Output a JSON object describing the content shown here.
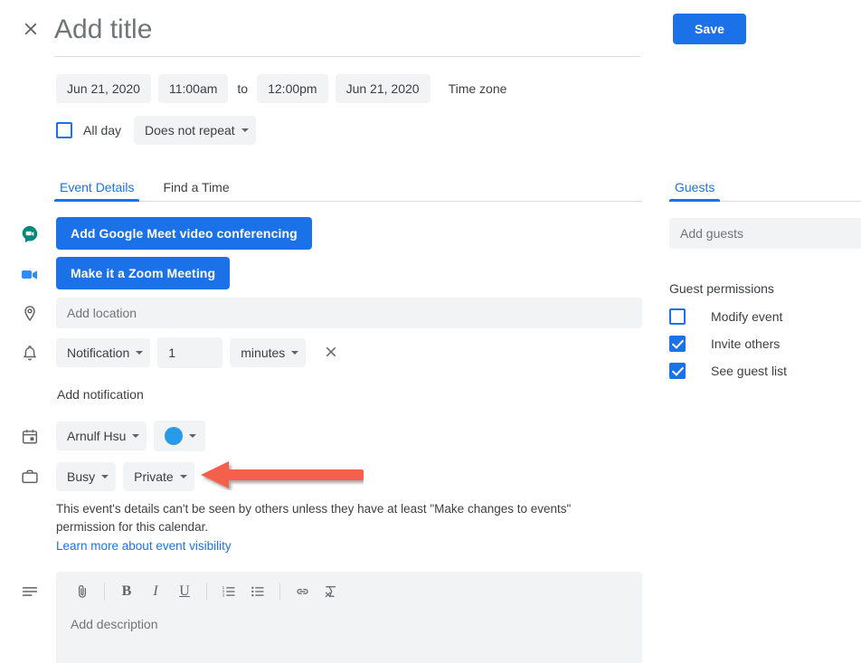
{
  "header": {
    "close_icon": "close-icon",
    "title_placeholder": "Add title",
    "title_value": "",
    "save_label": "Save"
  },
  "schedule": {
    "start_date": "Jun 21, 2020",
    "start_time": "11:00am",
    "to_label": "to",
    "end_time": "12:00pm",
    "end_date": "Jun 21, 2020",
    "timezone_label": "Time zone",
    "all_day_label": "All day",
    "all_day_checked": false,
    "repeat_label": "Does not repeat"
  },
  "tabs": {
    "items": [
      {
        "label": "Event Details",
        "active": true
      },
      {
        "label": "Find a Time",
        "active": false
      }
    ]
  },
  "details": {
    "meet_button_label": "Add Google Meet video conferencing",
    "zoom_button_label": "Make it a Zoom Meeting",
    "location_placeholder": "Add location",
    "location_value": "",
    "notification": {
      "type_label": "Notification",
      "amount_value": "1",
      "unit_label": "minutes",
      "remove_icon": "close-icon",
      "add_label": "Add notification"
    },
    "calendar": {
      "owner_label": "Arnulf Hsu",
      "color_hex": "#279bea"
    },
    "availability_label": "Busy",
    "visibility_label": "Private",
    "visibility_note": "This event's details can't be seen by others unless they have at least \"Make changes to events\" permission for this calendar.",
    "learn_more_label": "Learn more about event visibility",
    "description_placeholder": "Add description",
    "description_value": "",
    "editor_tools": [
      {
        "name": "attach-icon",
        "glyph": ""
      },
      {
        "name": "bold-icon",
        "glyph": "B"
      },
      {
        "name": "italic-icon",
        "glyph": "I"
      },
      {
        "name": "underline-icon",
        "glyph": "U"
      },
      {
        "name": "numbered-list-icon",
        "glyph": ""
      },
      {
        "name": "bulleted-list-icon",
        "glyph": ""
      },
      {
        "name": "link-icon",
        "glyph": ""
      },
      {
        "name": "remove-formatting-icon",
        "glyph": ""
      }
    ]
  },
  "guests": {
    "tab_label": "Guests",
    "input_placeholder": "Add guests",
    "input_value": "",
    "permissions_title": "Guest permissions",
    "permissions": [
      {
        "label": "Modify event",
        "checked": false
      },
      {
        "label": "Invite others",
        "checked": true
      },
      {
        "label": "See guest list",
        "checked": true
      }
    ]
  },
  "annotation": {
    "arrow_color": "#f4604c",
    "arrow_direction": "left",
    "points_at": "Private"
  },
  "colors": {
    "accent_blue": "#1a73e8",
    "button_blue": "#1b72e8",
    "field_gray": "#f1f3f4",
    "text_primary": "#3c4043",
    "text_secondary": "#70757a",
    "meet_green": "#00897b",
    "zoom_blue": "#2d8cff"
  }
}
